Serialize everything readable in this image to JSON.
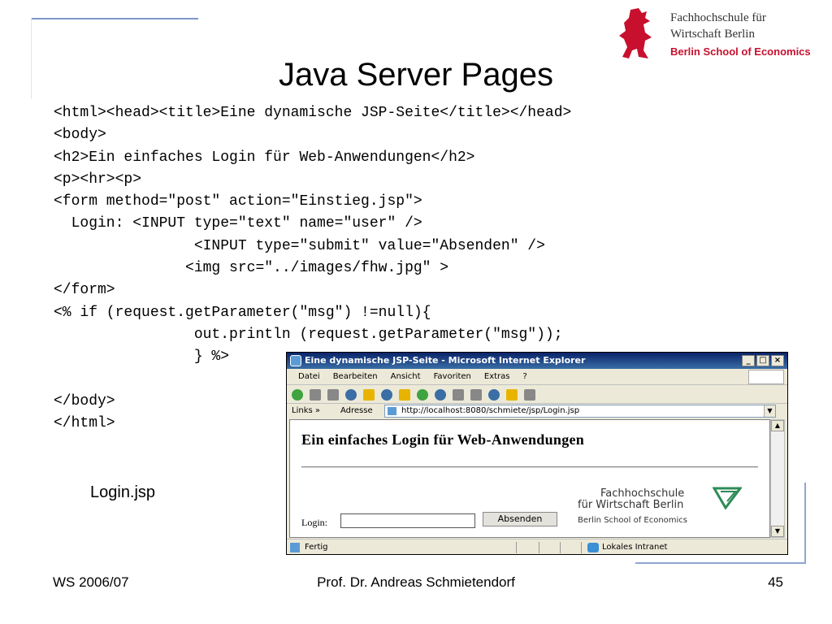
{
  "slide": {
    "title": "Java Server Pages",
    "code_lines": [
      "<html><head><title>Eine dynamische JSP-Seite</title></head>",
      "<body>",
      "<h2>Ein einfaches Login für Web-Anwendungen</h2>",
      "<p><hr><p>",
      "<form method=\"post\" action=\"Einstieg.jsp\">",
      "  Login: <INPUT type=\"text\" name=\"user\" />",
      "                <INPUT type=\"submit\" value=\"Absenden\" />",
      "               <img src=\"../images/fhw.jpg\" >",
      "</form>",
      "<% if (request.getParameter(\"msg\") !=null){",
      "                out.println (request.getParameter(\"msg\"));",
      "                } %>",
      "",
      "</body>",
      "</html>"
    ],
    "caption": "Login.jsp"
  },
  "logo": {
    "line1": "Fachhochschule für",
    "line2": "Wirtschaft Berlin",
    "line3": "Berlin School of Economics"
  },
  "footer": {
    "left": "WS 2006/07",
    "center": "Prof. Dr. Andreas Schmietendorf",
    "page": "45"
  },
  "browser": {
    "title": "Eine dynamische JSP-Seite - Microsoft Internet Explorer",
    "menu": [
      "Datei",
      "Bearbeiten",
      "Ansicht",
      "Favoriten",
      "Extras",
      "?"
    ],
    "links_label": "Links",
    "links_chevron": "»",
    "address_label": "Adresse",
    "url": "http://localhost:8080/schmiete/jsp/Login.jsp",
    "page_heading": "Ein einfaches Login für Web-Anwendungen",
    "login_label": "Login:",
    "submit_label": "Absenden",
    "fhw_line1": "Fachhochschule",
    "fhw_line2": "für Wirtschaft Berlin",
    "fhw_line3": "Berlin School of Economics",
    "status": "Fertig",
    "zone": "Lokales Intranet"
  },
  "colors": {
    "brand_red": "#c8102e",
    "titlebar": "#0a246a",
    "fhw_green": "#2e8b57"
  }
}
